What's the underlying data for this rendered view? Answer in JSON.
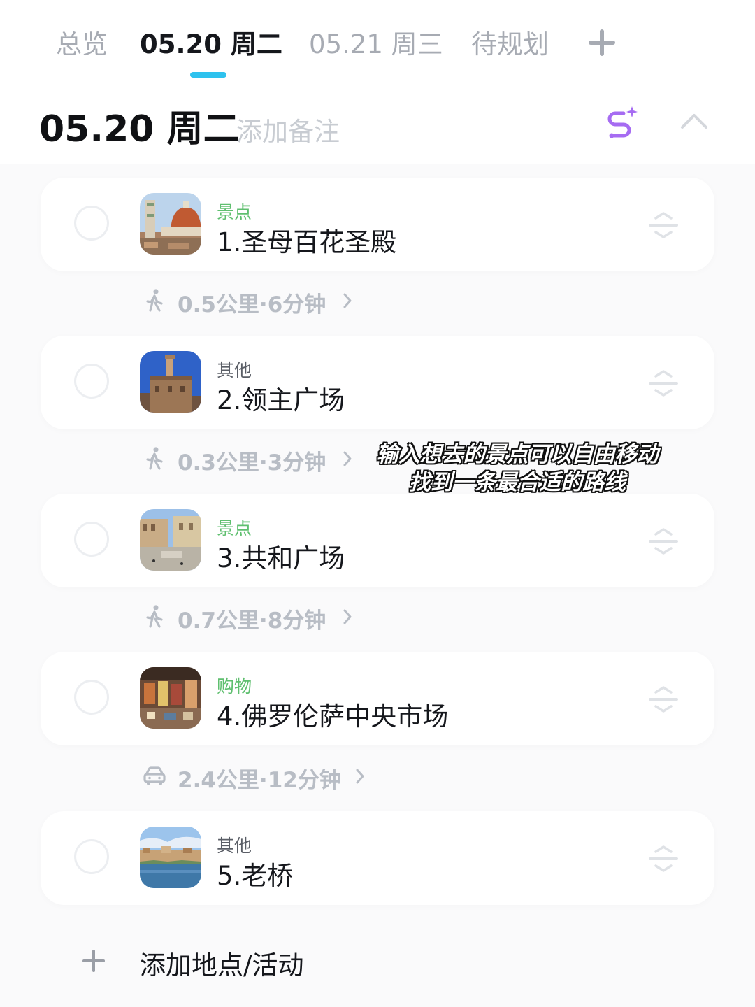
{
  "tabs": [
    {
      "label": "总览",
      "active": false
    },
    {
      "label": "05.20 周二",
      "active": true
    },
    {
      "label": "05.21 周三",
      "active": false
    },
    {
      "label": "待规划",
      "active": false
    }
  ],
  "colors": {
    "accent": "#2ec2ee",
    "route_icon": "#a66cf2",
    "category_green": "#5fbf6f"
  },
  "day": {
    "title": "05.20 周二",
    "note_placeholder": "添加备注"
  },
  "places": [
    {
      "category": "景点",
      "name": "1.圣母百花圣殿",
      "thumb": "cathedral-photo"
    },
    {
      "category": "其他",
      "name": "2.领主广场",
      "thumb": "palazzo-photo"
    },
    {
      "category": "景点",
      "name": "3.共和广场",
      "thumb": "piazza-photo"
    },
    {
      "category": "购物",
      "name": "4.佛罗伦萨中央市场",
      "thumb": "market-photo"
    },
    {
      "category": "其他",
      "name": "5.老桥",
      "thumb": "bridge-photo"
    }
  ],
  "transits": [
    {
      "mode": "walk-icon",
      "text": "0.5公里·6分钟"
    },
    {
      "mode": "walk-icon",
      "text": "0.3公里·3分钟"
    },
    {
      "mode": "walk-icon",
      "text": "0.7公里·8分钟"
    },
    {
      "mode": "car-icon",
      "text": "2.4公里·12分钟"
    }
  ],
  "add_place_label": "添加地点/活动",
  "caption": {
    "line1": "输入想去的景点可以自由移动",
    "line2": "找到一条最合适的路线"
  }
}
